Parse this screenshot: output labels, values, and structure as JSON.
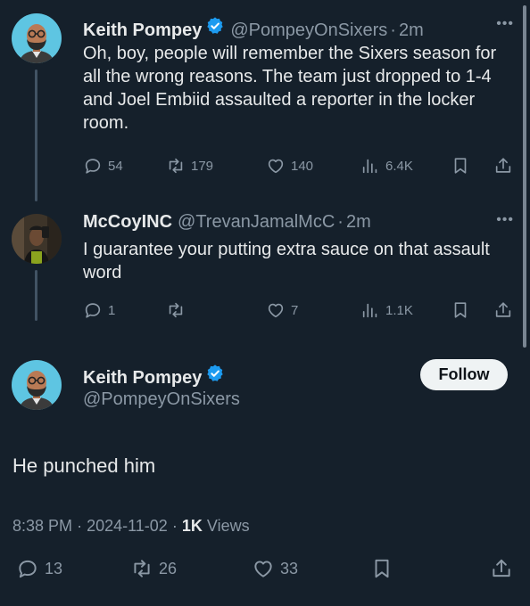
{
  "tweets": [
    {
      "name": "Keith Pompey",
      "handle": "@PompeyOnSixers",
      "time": "2m",
      "text": "Oh, boy,  people will remember the Sixers season for all the wrong reasons. The team just dropped to 1-4 and Joel Embiid assaulted a reporter in the locker room.",
      "replies": "54",
      "retweets": "179",
      "likes": "140",
      "views": "6.4K"
    },
    {
      "name": "McCoyINC",
      "handle": "@TrevanJamalMcC",
      "time": "2m",
      "text": "I guarantee your putting extra sauce on that assault word",
      "replies": "1",
      "retweets": "",
      "likes": "7",
      "views": "1.1K"
    }
  ],
  "main": {
    "name": "Keith Pompey",
    "handle": "@PompeyOnSixers",
    "follow_label": "Follow",
    "text": "He punched him",
    "time": "8:38 PM",
    "date": "2024-11-02",
    "views_count": "1K",
    "views_label": "Views",
    "replies": "13",
    "retweets": "26",
    "likes": "33"
  },
  "separator": "·",
  "icons": [
    "reply-icon",
    "retweet-icon",
    "like-icon",
    "views-icon",
    "bookmark-icon",
    "share-icon",
    "verified-badge-icon",
    "more-icon"
  ],
  "colors": {
    "background": "#15202b",
    "muted": "#8b98a5",
    "text": "#e7e9ea",
    "verified": "#1d9bf0",
    "thread_line": "#425364"
  }
}
